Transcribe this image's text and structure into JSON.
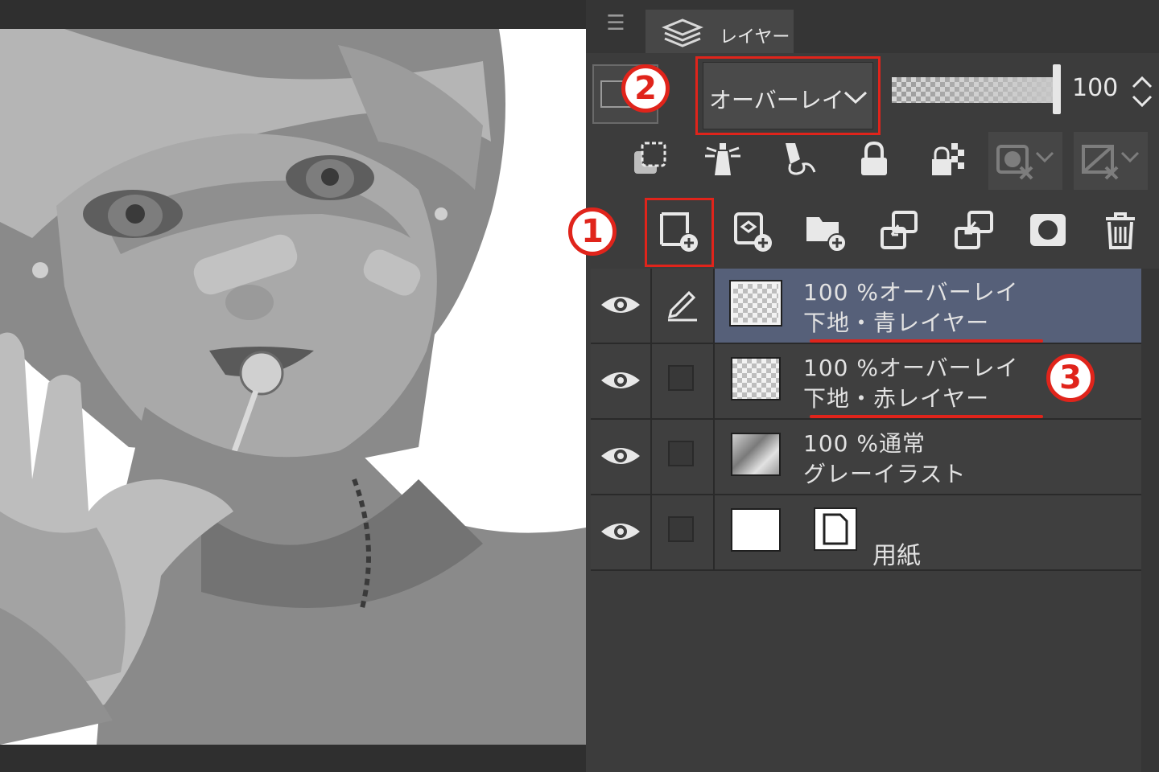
{
  "panel": {
    "menu_glyph": "☰",
    "tab_label": "レイヤー"
  },
  "properties": {
    "blend_mode": "オーバーレイ",
    "opacity": "100"
  },
  "markers": [
    "1",
    "2",
    "3"
  ],
  "layers": [
    {
      "line1": "100 %オーバーレイ",
      "line2": "下地・青レイヤー",
      "selected": true,
      "visible": true,
      "editing": true
    },
    {
      "line1": "100 %オーバーレイ",
      "line2": "下地・赤レイヤー",
      "selected": false,
      "visible": true
    },
    {
      "line1": "100 %通常",
      "line2": "グレーイラスト",
      "selected": false,
      "visible": true
    },
    {
      "line1": "",
      "line2": "用紙",
      "selected": false,
      "visible": true
    }
  ],
  "icons": {
    "tab": "layers-stack-icon",
    "blend_dropdown": "chevron-down-icon",
    "opacity_stepper": "up-down-arrows-icon",
    "flags": [
      "clip-to-layer-below-icon",
      "reference-layer-icon",
      "draft-layer-icon",
      "lock-layer-icon",
      "lock-transparency-icon",
      "mask-enable-icon",
      "mask-show-icon"
    ],
    "actions": [
      "new-raster-layer-icon",
      "new-vector-layer-icon",
      "new-folder-icon",
      "transfer-to-lower-layer-icon",
      "merge-down-icon",
      "create-mask-icon",
      "delete-layer-icon"
    ],
    "rows": [
      "eye-icon",
      "pencil-icon",
      "paper-icon"
    ]
  },
  "colors": {
    "annotation_red": "#e0241b",
    "selected_row": "#566079",
    "panel_bg": "#3c3c3c"
  }
}
